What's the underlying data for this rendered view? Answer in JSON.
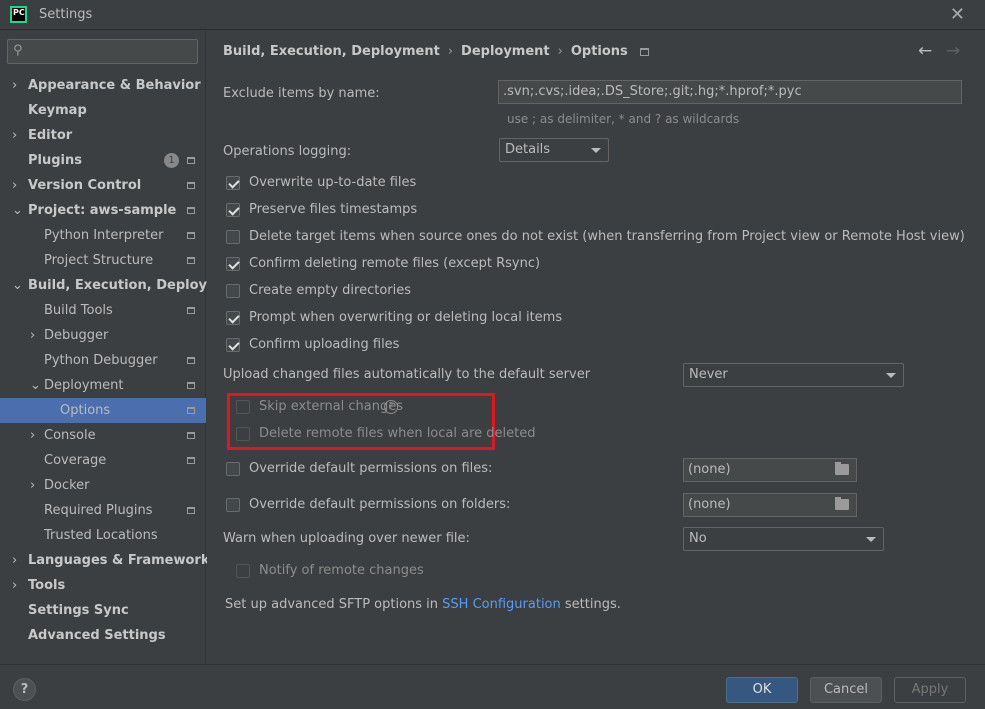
{
  "window": {
    "title": "Settings",
    "logo_text": "PC"
  },
  "sidebar": {
    "search_placeholder": "",
    "items": [
      {
        "label": "Appearance & Behavior",
        "chevron": "›"
      },
      {
        "label": "Keymap"
      },
      {
        "label": "Editor",
        "chevron": "›"
      },
      {
        "label": "Plugins",
        "badge": "1"
      },
      {
        "label": "Version Control",
        "chevron": "›"
      },
      {
        "label": "Project: aws-sample",
        "chevron": "⌄"
      },
      {
        "label": "Python Interpreter"
      },
      {
        "label": "Project Structure"
      },
      {
        "label": "Build, Execution, Deployment",
        "chevron": "⌄"
      },
      {
        "label": "Build Tools"
      },
      {
        "label": "Debugger",
        "chevron": "›"
      },
      {
        "label": "Python Debugger"
      },
      {
        "label": "Deployment",
        "chevron": "⌄"
      },
      {
        "label": "Options"
      },
      {
        "label": "Console",
        "chevron": "›"
      },
      {
        "label": "Coverage"
      },
      {
        "label": "Docker",
        "chevron": "›"
      },
      {
        "label": "Required Plugins"
      },
      {
        "label": "Trusted Locations"
      },
      {
        "label": "Languages & Frameworks",
        "chevron": "›"
      },
      {
        "label": "Tools",
        "chevron": "›"
      },
      {
        "label": "Settings Sync"
      },
      {
        "label": "Advanced Settings"
      }
    ]
  },
  "breadcrumb": [
    "Build, Execution, Deployment",
    "Deployment",
    "Options"
  ],
  "breadcrumb_sep": "›",
  "nav": {
    "back": "←",
    "forward": "→"
  },
  "exclude": {
    "label": "Exclude items by name:",
    "value": ".svn;.cvs;.idea;.DS_Store;.git;.hg;*.hprof;*.pyc",
    "hint": "use ; as delimiter, * and ? as wildcards"
  },
  "operations_logging": {
    "label": "Operations logging:",
    "value": "Details"
  },
  "checkboxes": [
    {
      "label": "Overwrite up-to-date files",
      "checked": true
    },
    {
      "label": "Preserve files timestamps",
      "checked": true
    },
    {
      "label": "Delete target items when source ones do not exist (when transferring from Project view or Remote Host view)",
      "checked": false
    },
    {
      "label": "Confirm deleting remote files (except Rsync)",
      "checked": true
    },
    {
      "label": "Create empty directories",
      "checked": false
    },
    {
      "label": "Prompt when overwriting or deleting local items",
      "checked": true
    },
    {
      "label": "Confirm uploading files",
      "checked": true
    }
  ],
  "upload_auto": {
    "label": "Upload changed files automatically to the default server",
    "value": "Never"
  },
  "sub_options": [
    {
      "label": "Skip external changes",
      "checked": false,
      "disabled": true
    },
    {
      "label": "Delete remote files when local are deleted",
      "checked": false,
      "disabled": true
    }
  ],
  "help_glyph": "?",
  "override_files": {
    "label": "Override default permissions on files:",
    "value": "(none)"
  },
  "override_folders": {
    "label": "Override default permissions on folders:",
    "value": "(none)"
  },
  "warn_uploading": {
    "label": "Warn when uploading over newer file:",
    "value": "No"
  },
  "notify_remote": {
    "label": "Notify of remote changes",
    "checked": false,
    "disabled": true
  },
  "sftp": {
    "prefix": "Set up advanced SFTP options in ",
    "link": "SSH Configuration",
    "suffix": " settings."
  },
  "footer": {
    "help": "?",
    "ok": "OK",
    "cancel": "Cancel",
    "apply": "Apply"
  },
  "colors": {
    "background": "#3c3f41",
    "selection": "#4b6eaf",
    "highlight": "#e3151f",
    "link": "#589df6",
    "primary_button": "#365880"
  }
}
